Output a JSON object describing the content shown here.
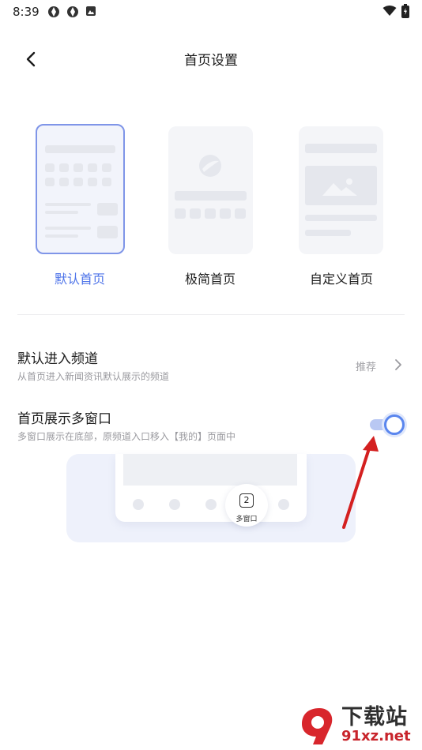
{
  "status_bar": {
    "time": "8:39"
  },
  "header": {
    "title": "首页设置"
  },
  "layouts": [
    {
      "label": "默认首页",
      "selected": true
    },
    {
      "label": "极简首页",
      "selected": false
    },
    {
      "label": "自定义首页",
      "selected": false
    }
  ],
  "settings": {
    "default_channel": {
      "title": "默认进入频道",
      "subtitle": "从首页进入新闻资讯默认展示的频道",
      "value": "推荐"
    },
    "multi_window": {
      "title": "首页展示多窗口",
      "subtitle": "多窗口展示在底部，原频道入口移入【我的】页面中",
      "enabled": true
    }
  },
  "preview": {
    "count": "2",
    "label": "多窗口"
  },
  "watermark": {
    "top": "下载站",
    "bottom": "91xz.net"
  },
  "colors": {
    "accent": "#4d73e9",
    "arrow": "#d42020"
  }
}
